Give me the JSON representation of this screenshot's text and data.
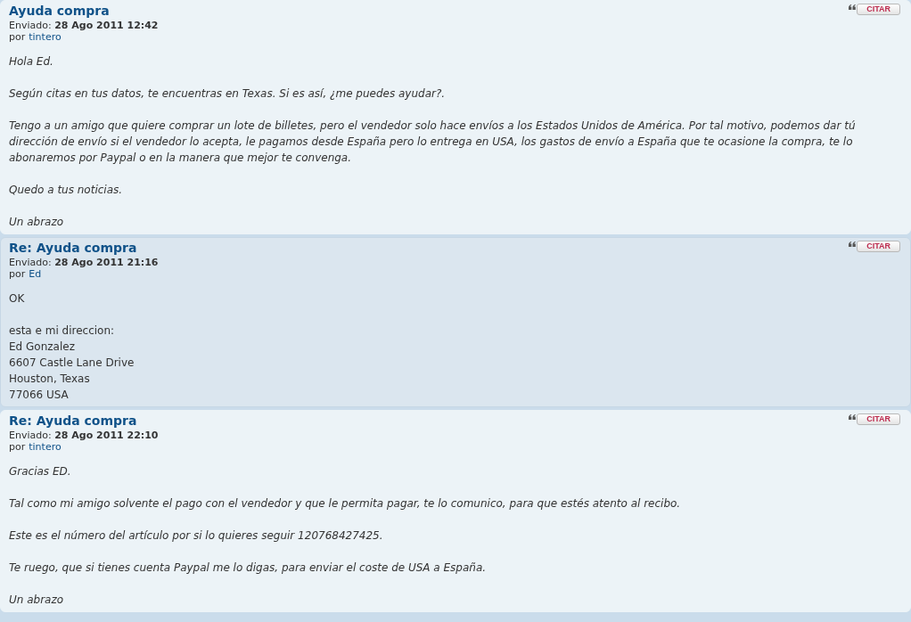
{
  "posts": [
    {
      "highlighted": false,
      "italic": true,
      "title": "Ayuda compra",
      "quote_button": "CITAR",
      "sent_label": "Enviado:",
      "date": "28 Ago 2011 12:42",
      "by_label": "por",
      "author": "tintero",
      "paragraphs": [
        [
          "Hola Ed."
        ],
        [
          "Según citas en tus datos, te encuentras en Texas. Si es así, ¿me puedes ayudar?."
        ],
        [
          "Tengo a un amigo que quiere comprar un lote de billetes, pero el vendedor solo hace envíos a los Estados Unidos de América. Por tal motivo, podemos dar tú dirección de envío si el vendedor lo acepta, le pagamos desde España pero lo entrega en USA, los gastos de envío a España que te ocasione la compra, te lo abonaremos por Paypal o en la manera que mejor te convenga."
        ],
        [
          "Quedo a tus noticias."
        ],
        [
          "Un abrazo"
        ]
      ]
    },
    {
      "highlighted": true,
      "italic": false,
      "title": "Re: Ayuda compra",
      "quote_button": "CITAR",
      "sent_label": "Enviado:",
      "date": "28 Ago 2011 21:16",
      "by_label": "por",
      "author": "Ed",
      "paragraphs": [
        [
          "OK"
        ],
        [
          "esta e mi direccion:",
          "Ed Gonzalez",
          "6607 Castle Lane Drive",
          "Houston, Texas",
          "77066 USA"
        ]
      ]
    },
    {
      "highlighted": false,
      "italic": true,
      "title": "Re: Ayuda compra",
      "quote_button": "CITAR",
      "sent_label": "Enviado:",
      "date": "28 Ago 2011 22:10",
      "by_label": "por",
      "author": "tintero",
      "paragraphs": [
        [
          "Gracias ED."
        ],
        [
          "Tal como mi amigo solvente el pago con el vendedor y que le permita pagar, te lo comunico, para que estés atento al recibo."
        ],
        [
          "Este es el número del artículo por si lo quieres seguir 120768427425."
        ],
        [
          "Te ruego, que si tienes cuenta Paypal me lo digas, para enviar el coste de USA a España."
        ],
        [
          "Un abrazo"
        ]
      ]
    }
  ]
}
